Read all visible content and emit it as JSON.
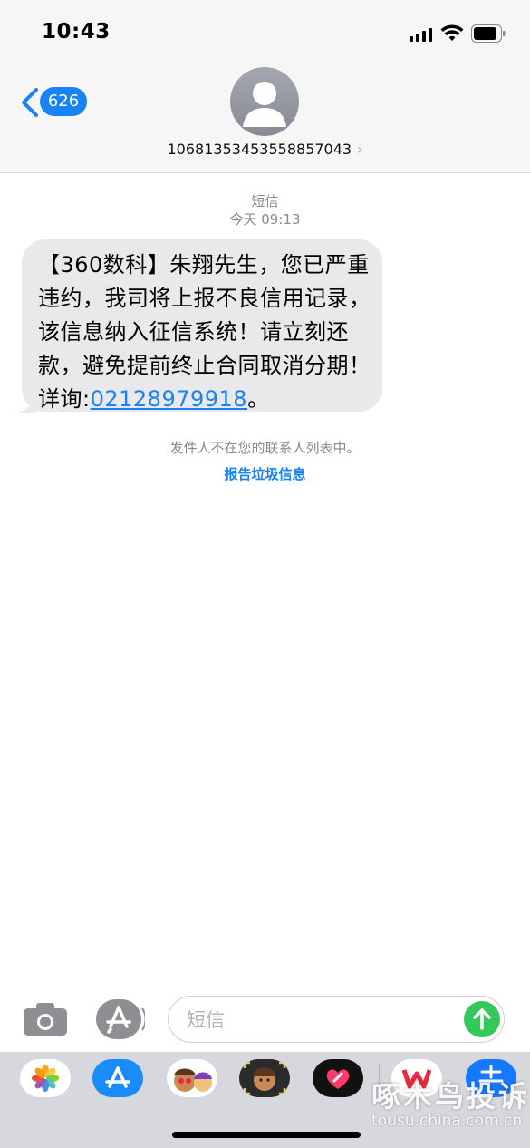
{
  "status_bar": {
    "time": "10:43"
  },
  "header": {
    "back_count": "626",
    "contact_number": "10681353453558857043",
    "contact_chevron": "›"
  },
  "conversation": {
    "service_label": "短信",
    "timestamp": "今天 09:13",
    "message": {
      "text_before_link": "【360数科】朱翔先生，您已严重违约，我司将上报不良信用记录，该信息纳入征信系统！请立刻还款，避免提前终止合同取消分期！详询:",
      "link": "02128979918",
      "text_after_link": "。"
    },
    "unknown_sender_note": "发件人不在您的联系人列表中。",
    "report_junk_label": "报告垃圾信息"
  },
  "composer": {
    "placeholder": "短信"
  },
  "app_strip": {
    "apps": [
      "photos-app-icon",
      "app-store-app-icon",
      "memoji-stickers-app-icon",
      "memoji-app-icon",
      "digital-touch-app-icon",
      "wps-app-icon",
      "alipay-app-icon"
    ]
  },
  "watermark": {
    "title": "啄木鸟投诉",
    "url": "tousu.china.com.cn"
  },
  "colors": {
    "accent": "#1a82f7",
    "send": "#34c759",
    "bubble": "#e9e9eb"
  }
}
